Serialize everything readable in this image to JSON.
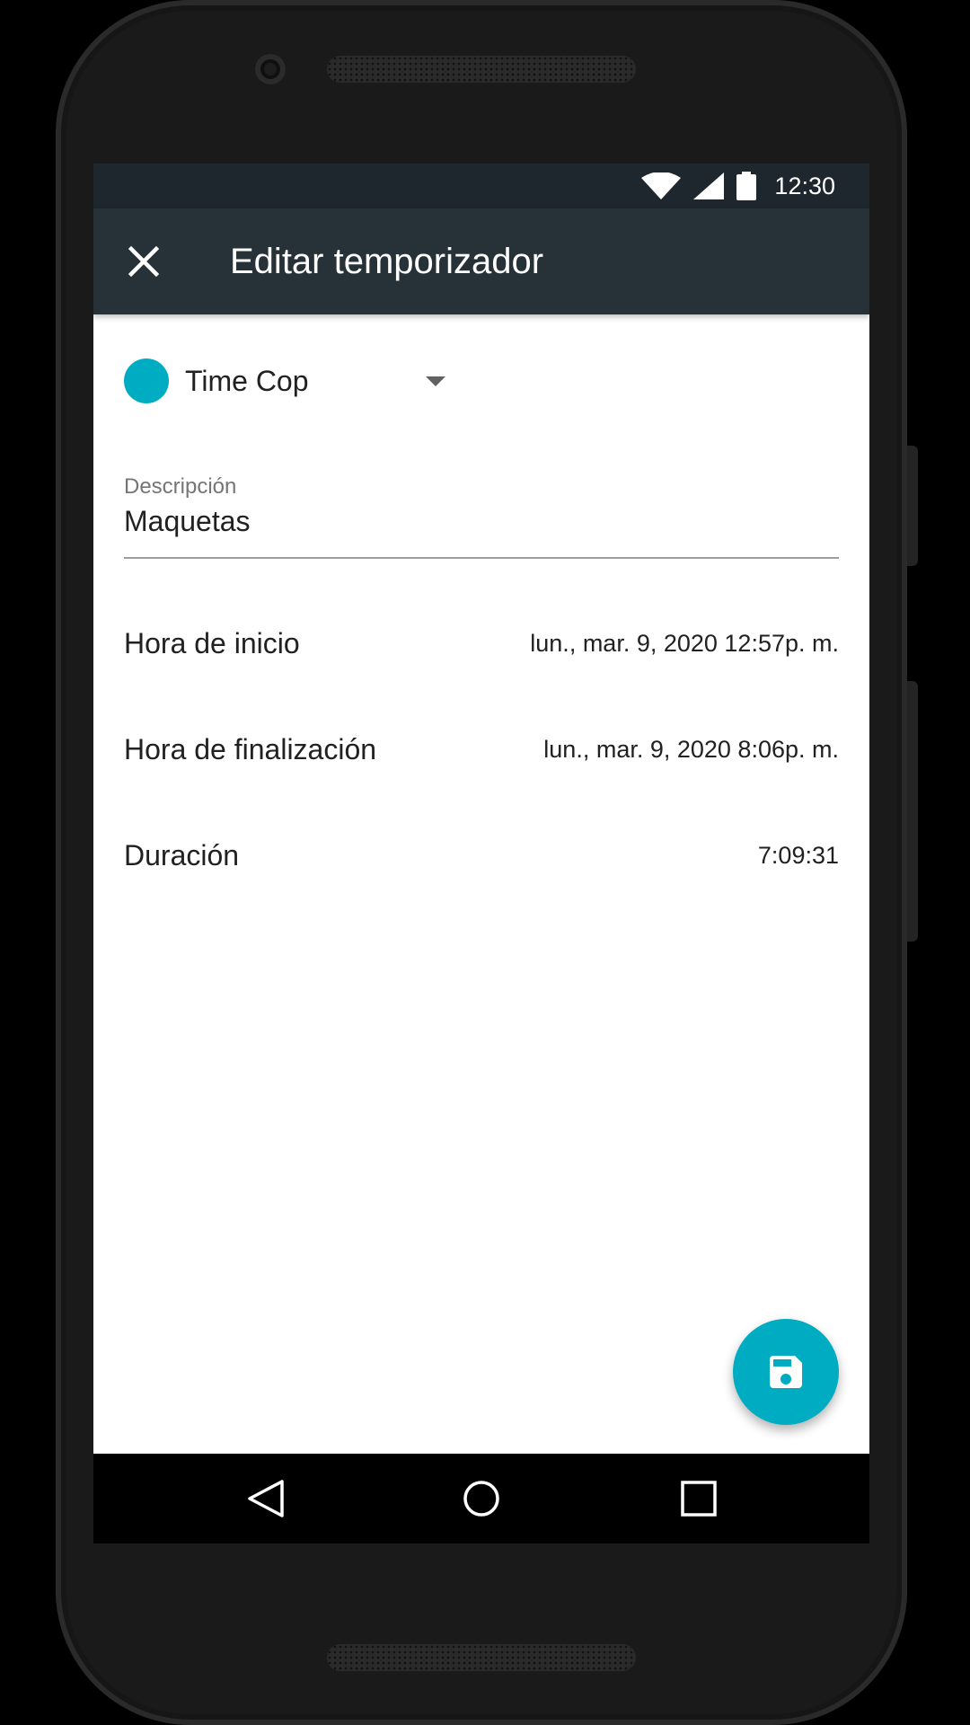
{
  "status_bar": {
    "time": "12:30",
    "icons": [
      "wifi-icon",
      "signal-icon",
      "battery-icon"
    ]
  },
  "app_bar": {
    "close_icon": "close-icon",
    "title": "Editar temporizador"
  },
  "project": {
    "name": "Time Cop",
    "color": "#00acc1",
    "dropdown_icon": "dropdown-arrow-icon"
  },
  "description": {
    "label": "Descripción",
    "value": "Maquetas"
  },
  "start": {
    "label": "Hora de inicio",
    "value": "lun., mar. 9, 2020 12:57p. m."
  },
  "end": {
    "label": "Hora de finalización",
    "value": "lun., mar. 9, 2020 8:06p. m."
  },
  "duration": {
    "label": "Duración",
    "value": "7:09:31"
  },
  "fab": {
    "icon": "save-icon",
    "color": "#00acc1"
  },
  "nav_bar": {
    "icons": [
      "back-icon",
      "home-icon",
      "recents-icon"
    ]
  },
  "colors": {
    "app_bar": "#263238",
    "status_bar": "#1e272e",
    "accent": "#00acc1"
  }
}
